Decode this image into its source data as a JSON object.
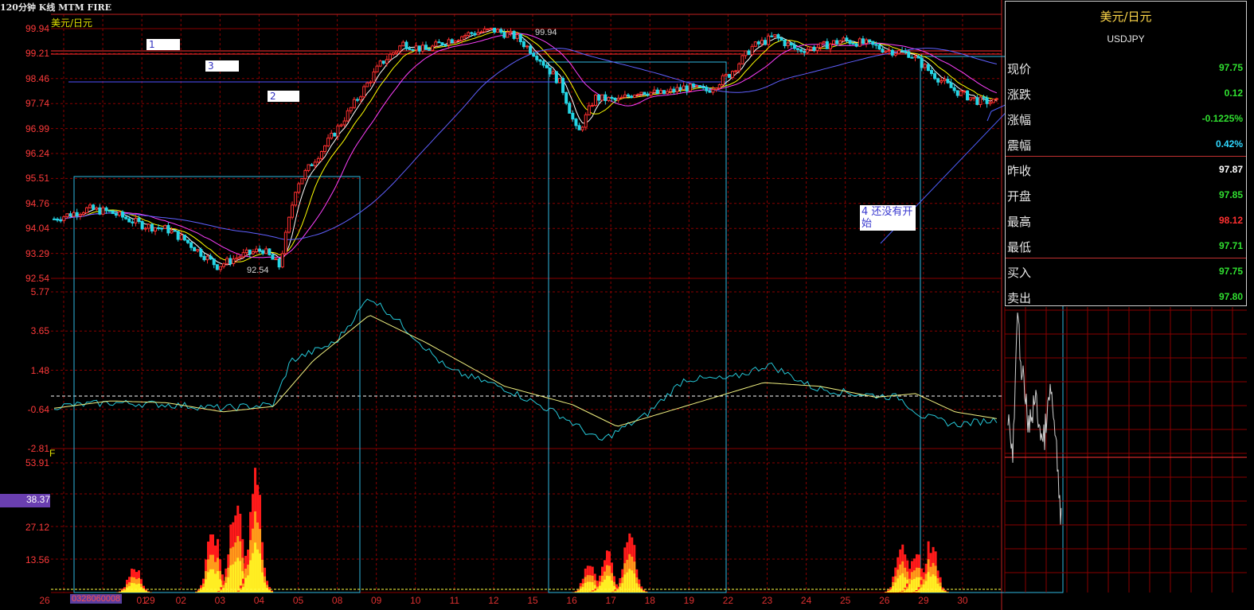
{
  "header": {
    "title": "120分钟 K线 MTM FIRE",
    "symbol": "美元/日元"
  },
  "colors": {
    "up": "#ff3030",
    "down": "#25d6e6",
    "grid": "#8a0000",
    "ma5": "#ffffff",
    "ma10": "#ffff00",
    "ma20": "#ff40ff",
    "ma60": "#6060ff",
    "mtm": "#25c8d8",
    "mtm_ma": "#f0f080",
    "box": "#30b8e0"
  },
  "price_axis": {
    "ticks": [
      "99.94",
      "99.21",
      "98.46",
      "97.74",
      "96.99",
      "96.24",
      "95.51",
      "94.76",
      "94.04",
      "93.29",
      "92.54"
    ],
    "high_label": "99.94",
    "low_label": "92.54"
  },
  "mtm_axis": {
    "ticks": [
      "5.77",
      "3.65",
      "1.48",
      "-0.64",
      "-2.81"
    ]
  },
  "fire_axis": {
    "marker": "F",
    "ticks": [
      "53.91",
      "38.37",
      "27.12",
      "13.56"
    ],
    "highlight": "38.37"
  },
  "x_axis": {
    "labels": [
      "26",
      "29",
      "01",
      "02",
      "03",
      "04",
      "05",
      "08",
      "09",
      "10",
      "11",
      "12",
      "15",
      "16",
      "17",
      "18",
      "19",
      "22",
      "23",
      "24",
      "25",
      "26",
      "29",
      "30"
    ],
    "date_box": "0328060008"
  },
  "annotations": {
    "n1": "1",
    "n2": "2",
    "n3": "3",
    "n4": "4 还没有开始"
  },
  "quote_panel": {
    "name": "美元/日元",
    "code": "USDJPY",
    "rows": [
      {
        "label": "现价",
        "value": "97.75",
        "color": "#30e030"
      },
      {
        "label": "涨跌",
        "value": "0.12",
        "color": "#30e030"
      },
      {
        "label": "涨幅",
        "value": "-0.1225%",
        "color": "#30e030"
      },
      {
        "label": "震幅",
        "value": "0.42%",
        "color": "#30d8ff"
      },
      {
        "label": "昨收",
        "value": "97.87",
        "color": "#ffffff"
      },
      {
        "label": "开盘",
        "value": "97.85",
        "color": "#30e030"
      },
      {
        "label": "最高",
        "value": "98.12",
        "color": "#ff3030"
      },
      {
        "label": "最低",
        "value": "97.71",
        "color": "#30e030"
      },
      {
        "label": "买入",
        "value": "97.75",
        "color": "#30e030"
      },
      {
        "label": "卖出",
        "value": "97.80",
        "color": "#30e030"
      }
    ]
  },
  "chart_data": {
    "type": "candlestick",
    "title": "120分钟 K线 MTM FIRE",
    "series_label": "美元/日元",
    "x_labels": [
      "26",
      "29",
      "01",
      "02",
      "03",
      "04",
      "05",
      "08",
      "09",
      "10",
      "11",
      "12",
      "15",
      "16",
      "17",
      "18",
      "19",
      "22",
      "23",
      "24",
      "25",
      "26",
      "29",
      "30"
    ],
    "ylim": [
      92.54,
      99.94
    ],
    "close_path": [
      [
        0,
        94.3
      ],
      [
        0.6,
        94.6
      ],
      [
        1.0,
        94.5
      ],
      [
        1.6,
        94.1
      ],
      [
        2.0,
        94.0
      ],
      [
        2.3,
        93.7
      ],
      [
        2.6,
        93.3
      ],
      [
        2.9,
        92.9
      ],
      [
        3.3,
        93.2
      ],
      [
        3.7,
        93.4
      ],
      [
        4.0,
        92.9
      ],
      [
        4.3,
        95.3
      ],
      [
        4.6,
        96.0
      ],
      [
        5.0,
        96.9
      ],
      [
        5.4,
        97.9
      ],
      [
        5.8,
        98.9
      ],
      [
        6.2,
        99.5
      ],
      [
        6.6,
        99.3
      ],
      [
        7.0,
        99.6
      ],
      [
        7.4,
        99.8
      ],
      [
        7.8,
        99.9
      ],
      [
        8.2,
        99.7
      ],
      [
        8.6,
        99.1
      ],
      [
        9.0,
        98.3
      ],
      [
        9.3,
        96.8
      ],
      [
        9.6,
        97.9
      ],
      [
        10.0,
        97.8
      ],
      [
        10.4,
        98.1
      ],
      [
        10.8,
        98.0
      ],
      [
        11.2,
        98.2
      ],
      [
        11.6,
        98.1
      ],
      [
        12.0,
        98.6
      ],
      [
        12.4,
        99.4
      ],
      [
        12.8,
        99.7
      ],
      [
        13.2,
        99.3
      ],
      [
        13.6,
        99.4
      ],
      [
        14.0,
        99.6
      ],
      [
        14.4,
        99.5
      ],
      [
        14.8,
        99.3
      ],
      [
        15.2,
        99.2
      ],
      [
        15.6,
        98.6
      ],
      [
        16.0,
        98.1
      ],
      [
        16.4,
        97.8
      ],
      [
        16.8,
        97.75
      ]
    ],
    "mtm": {
      "ylim": [
        -2.81,
        5.77
      ],
      "path": [
        [
          0,
          -0.5
        ],
        [
          1,
          -0.3
        ],
        [
          2,
          -0.4
        ],
        [
          3,
          -0.6
        ],
        [
          3.9,
          -0.4
        ],
        [
          4.2,
          2.0
        ],
        [
          5.0,
          3.0
        ],
        [
          5.6,
          5.5
        ],
        [
          6.0,
          4.5
        ],
        [
          7.0,
          1.5
        ],
        [
          8.0,
          0.5
        ],
        [
          9.0,
          -1.0
        ],
        [
          9.7,
          -2.4
        ],
        [
          10.5,
          -1.0
        ],
        [
          11.2,
          1.0
        ],
        [
          12.0,
          1.0
        ],
        [
          12.7,
          1.8
        ],
        [
          13.5,
          0.5
        ],
        [
          14.2,
          0.2
        ],
        [
          15.0,
          0.0
        ],
        [
          15.4,
          -1.0
        ],
        [
          16.0,
          -1.5
        ],
        [
          16.8,
          -1.2
        ]
      ],
      "ma_path": [
        [
          0,
          -0.6
        ],
        [
          1,
          -0.2
        ],
        [
          2,
          -0.3
        ],
        [
          3,
          -0.8
        ],
        [
          3.9,
          -0.5
        ],
        [
          4.6,
          2.0
        ],
        [
          5.6,
          4.5
        ],
        [
          6.6,
          3.0
        ],
        [
          8.0,
          0.6
        ],
        [
          9.2,
          -0.4
        ],
        [
          10.0,
          -1.6
        ],
        [
          11.2,
          -0.5
        ],
        [
          12.6,
          0.8
        ],
        [
          13.6,
          0.6
        ],
        [
          14.6,
          0.0
        ],
        [
          15.3,
          0.2
        ],
        [
          16.0,
          -0.8
        ],
        [
          16.8,
          -1.2
        ]
      ]
    },
    "fire": {
      "ylim": [
        0,
        53.91
      ],
      "bursts": [
        [
          1.4,
          12
        ],
        [
          2.8,
          30
        ],
        [
          3.2,
          45
        ],
        [
          3.55,
          53.9
        ],
        [
          9.5,
          14
        ],
        [
          9.8,
          17
        ],
        [
          10.2,
          27
        ],
        [
          15.05,
          23
        ],
        [
          15.3,
          17
        ],
        [
          15.55,
          22
        ]
      ]
    }
  }
}
